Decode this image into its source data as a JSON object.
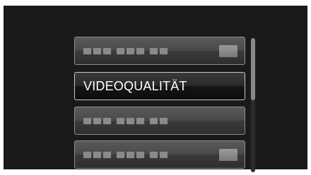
{
  "menu": {
    "items": [
      {
        "label": "",
        "blurred": true,
        "has_value_box": true
      },
      {
        "label": "VIDEOQUALITÄT",
        "blurred": false,
        "has_value_box": false,
        "selected": true
      },
      {
        "label": "",
        "blurred": true,
        "has_value_box": false
      },
      {
        "label": "",
        "blurred": true,
        "has_value_box": true
      }
    ]
  },
  "colors": {
    "background": "#1a1a1a",
    "item_border": "#8e8e8e",
    "selected_border": "#c9c9c9",
    "text": "#ffffff"
  }
}
